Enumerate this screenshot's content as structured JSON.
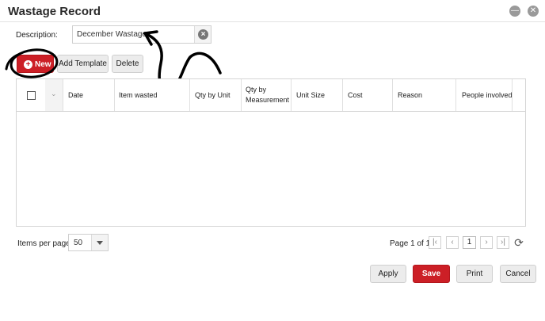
{
  "window": {
    "title": "Wastage Record",
    "icons": [
      "minimize-icon",
      "close-icon"
    ]
  },
  "description": {
    "label": "Description:",
    "value": "December Wastage",
    "clear_icon": "clear-icon"
  },
  "toolbar": {
    "new_label": "New",
    "add_template_label": "Add Template",
    "delete_label": "Delete",
    "accent_color": "#cc1f26"
  },
  "grid": {
    "columns": [
      "Date",
      "Item wasted",
      "Qty by Unit",
      "Qty by Measurement",
      "Unit Size",
      "Cost",
      "Reason",
      "People involved"
    ],
    "rows": []
  },
  "pagination": {
    "items_per_page_label": "Items per page:",
    "items_per_page_value": "50",
    "page_info": "Page 1 of 1",
    "current_page": "1"
  },
  "actions": {
    "apply_label": "Apply",
    "save_label": "Save",
    "print_label": "Print",
    "cancel_label": "Cancel"
  }
}
